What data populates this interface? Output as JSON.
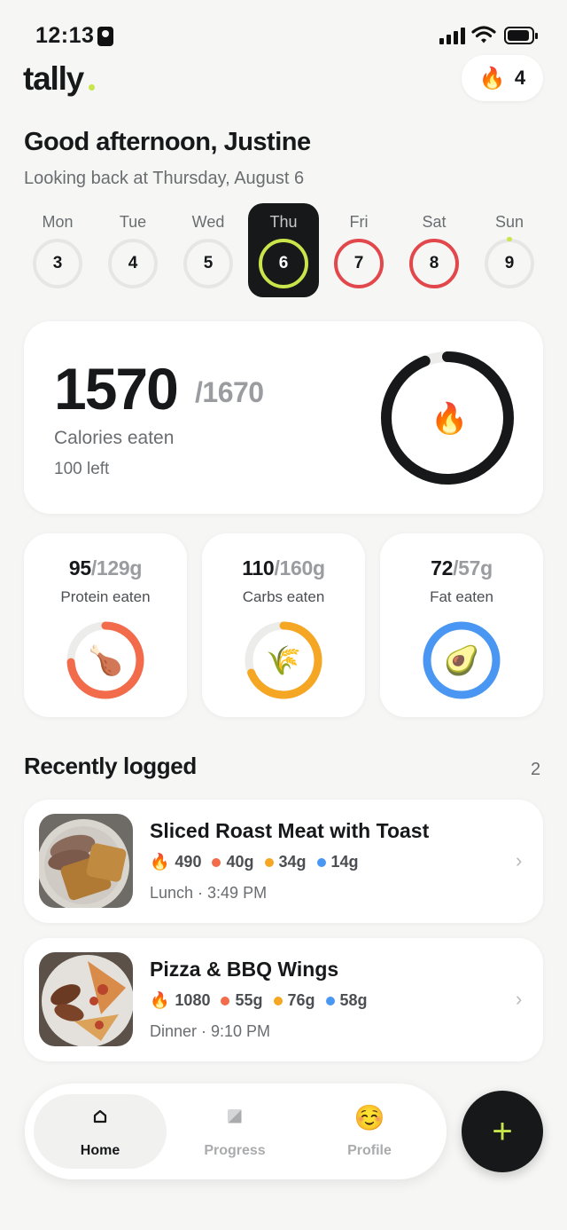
{
  "status": {
    "time": "12:13"
  },
  "app": {
    "logo": "tally",
    "streak_count": "4",
    "streak_icon": "fire-icon"
  },
  "greeting": {
    "title": "Good afternoon, Justine",
    "subtitle": "Looking back at Thursday, August 6"
  },
  "week": [
    {
      "label": "Mon",
      "date": "3",
      "state": "empty"
    },
    {
      "label": "Tue",
      "date": "4",
      "state": "empty"
    },
    {
      "label": "Wed",
      "date": "5",
      "state": "empty"
    },
    {
      "label": "Thu",
      "date": "6",
      "state": "selected"
    },
    {
      "label": "Fri",
      "date": "7",
      "state": "over"
    },
    {
      "label": "Sat",
      "date": "8",
      "state": "over"
    },
    {
      "label": "Sun",
      "date": "9",
      "state": "empty"
    }
  ],
  "calories": {
    "eaten": "1570",
    "goal": "/1670",
    "label": "Calories eaten",
    "left": "100 left",
    "progress": 0.94,
    "color": "#16181a"
  },
  "macros": [
    {
      "value": "95",
      "goal": "/129g",
      "label": "Protein eaten",
      "progress": 0.74,
      "color": "#f26b4b",
      "icon": "drumstick-icon"
    },
    {
      "value": "110",
      "goal": "/160g",
      "label": "Carbs eaten",
      "progress": 0.69,
      "color": "#f5a623",
      "icon": "rice-icon"
    },
    {
      "value": "72",
      "goal": "/57g",
      "label": "Fat eaten",
      "progress": 1.0,
      "color": "#4a97f3",
      "icon": "avocado-icon"
    }
  ],
  "recent": {
    "title": "Recently logged",
    "count": "2",
    "items": [
      {
        "name": "Sliced Roast Meat with Toast",
        "kcal": "490",
        "protein": "40g",
        "carbs": "34g",
        "fat": "14g",
        "meta": "Lunch · 3:49 PM"
      },
      {
        "name": "Pizza & BBQ Wings",
        "kcal": "1080",
        "protein": "55g",
        "carbs": "76g",
        "fat": "58g",
        "meta": "Dinner · 9:10 PM"
      }
    ]
  },
  "tabs": [
    {
      "label": "Home",
      "icon": "home-icon",
      "active": true
    },
    {
      "label": "Progress",
      "icon": "progress-icon",
      "active": false
    },
    {
      "label": "Profile",
      "icon": "smile-icon",
      "active": false
    }
  ],
  "fab": {
    "label": "+"
  },
  "colors": {
    "accent": "#c8e64b",
    "over": "#e2474b",
    "protein": "#f26b4b",
    "carbs": "#f5a623",
    "fat": "#4a97f3"
  }
}
